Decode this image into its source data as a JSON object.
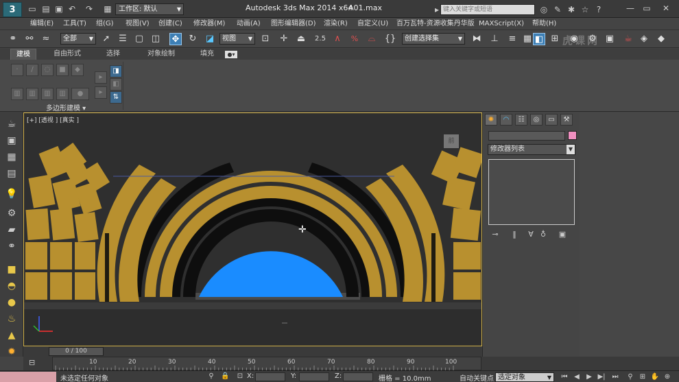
{
  "titlebar": {
    "logo": "3",
    "workspace_label": "工作区: 默认",
    "app_title": "Autodesk 3ds Max  2014 x64",
    "file_name": "A01.max",
    "search_placeholder": "键入关键字或短语",
    "min": "—",
    "max": "▭",
    "close": "✕"
  },
  "menu": {
    "items": [
      "编辑(E)",
      "工具(T)",
      "组(G)",
      "视图(V)",
      "创建(C)",
      "修改器(M)",
      "动画(A)",
      "图形编辑器(D)",
      "渲染(R)",
      "自定义(U)",
      "百万瓦特-资源收集丹华版",
      "MAXScript(X)",
      "帮助(H)"
    ]
  },
  "toolbar": {
    "filter": "全部",
    "coord": "视图",
    "snap_value": "2.5",
    "named_selection": "创建选择集"
  },
  "ribbon": {
    "tabs": [
      "建模",
      "自由形式",
      "选择",
      "对象绘制",
      "填充"
    ],
    "group_label": "多边形建模"
  },
  "viewport": {
    "label": "[+] [透视 ] [真实 ]",
    "cube_label": "前",
    "colors": {
      "gold": "#b8902f",
      "black": "#0e0e0e",
      "sky": "#1a8cff",
      "floor": "#3b3b3b"
    }
  },
  "command_panel": {
    "modifier_list": "修改器列表"
  },
  "timeline": {
    "frame_display": "0 / 100",
    "ticks": [
      "10",
      "20",
      "30",
      "40",
      "50",
      "60",
      "70",
      "80",
      "90",
      "100"
    ]
  },
  "status": {
    "message": "未选定任何对象",
    "x_label": "X:",
    "y_label": "Y:",
    "z_label": "Z:",
    "grid_label": "栅格 = 10.0mm",
    "autokey_label": "自动关键点",
    "selection_mode": "选定对象"
  },
  "watermark": "虎课网"
}
